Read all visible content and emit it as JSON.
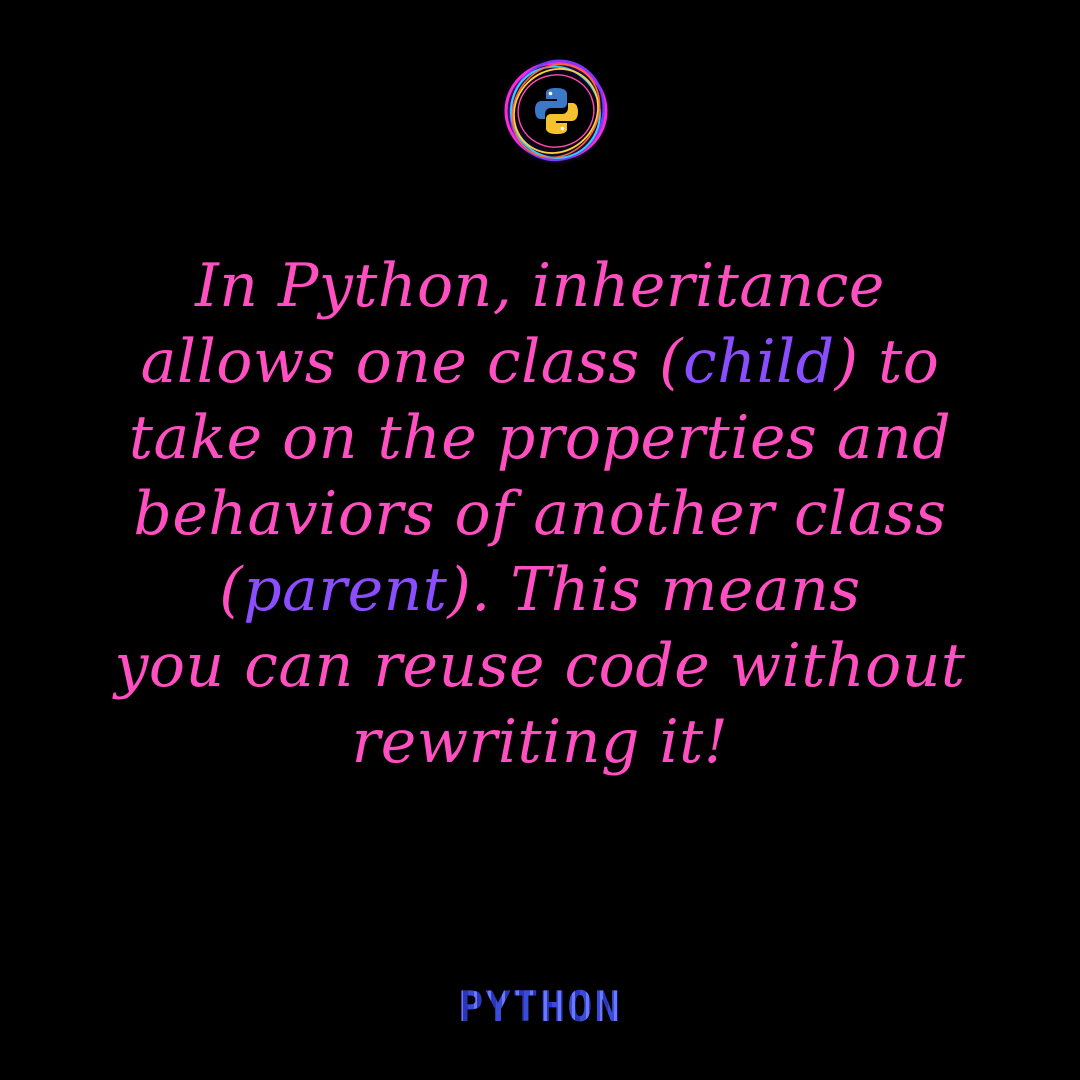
{
  "colors": {
    "background": "#000000",
    "text_pink": "#ff4fc0",
    "text_purple": "#8a4dff",
    "footer_blue": "#4a55d6"
  },
  "logo": {
    "icon": "python-logo-icon"
  },
  "quote": {
    "line1": "In Python, inheritance",
    "line2_a": "allows one class (",
    "line2_hl": "child",
    "line2_b": ") to",
    "line3": "take on the properties and",
    "line4": "behaviors of another class",
    "line5_a": "(",
    "line5_hl": "parent",
    "line5_b": "). This means",
    "line6": "you can reuse code without",
    "line7": "rewriting it!"
  },
  "footer": {
    "word": "PYTHON"
  }
}
